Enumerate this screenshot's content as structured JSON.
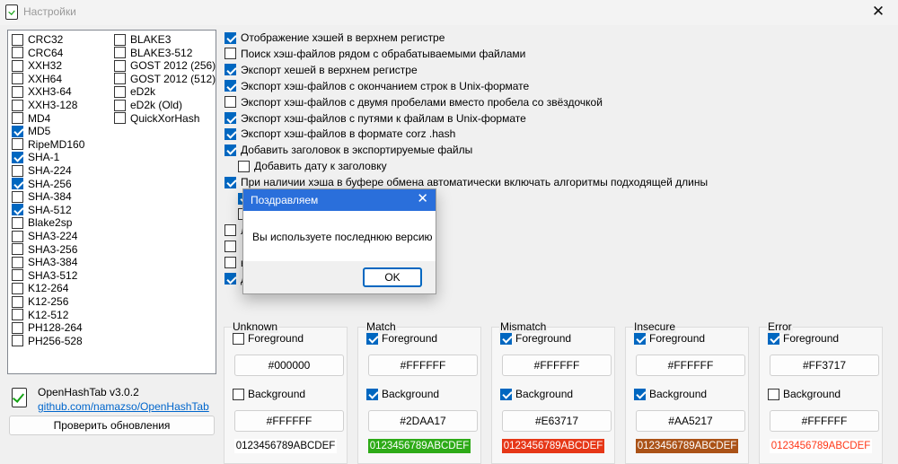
{
  "window": {
    "title": "Настройки",
    "close_glyph": "✕"
  },
  "algorithms": {
    "column1": [
      {
        "name": "CRC32",
        "checked": false
      },
      {
        "name": "CRC64",
        "checked": false
      },
      {
        "name": "XXH32",
        "checked": false
      },
      {
        "name": "XXH64",
        "checked": false
      },
      {
        "name": "XXH3-64",
        "checked": false
      },
      {
        "name": "XXH3-128",
        "checked": false
      },
      {
        "name": "MD4",
        "checked": false
      },
      {
        "name": "MD5",
        "checked": true
      },
      {
        "name": "RipeMD160",
        "checked": false
      },
      {
        "name": "SHA-1",
        "checked": true
      },
      {
        "name": "SHA-224",
        "checked": false
      },
      {
        "name": "SHA-256",
        "checked": true
      },
      {
        "name": "SHA-384",
        "checked": false
      },
      {
        "name": "SHA-512",
        "checked": true
      },
      {
        "name": "Blake2sp",
        "checked": false
      },
      {
        "name": "SHA3-224",
        "checked": false
      },
      {
        "name": "SHA3-256",
        "checked": false
      },
      {
        "name": "SHA3-384",
        "checked": false
      },
      {
        "name": "SHA3-512",
        "checked": false
      },
      {
        "name": "K12-264",
        "checked": false
      },
      {
        "name": "K12-256",
        "checked": false
      },
      {
        "name": "K12-512",
        "checked": false
      },
      {
        "name": "PH128-264",
        "checked": false
      },
      {
        "name": "PH256-528",
        "checked": false
      }
    ],
    "column2": [
      {
        "name": "BLAKE3",
        "checked": false
      },
      {
        "name": "BLAKE3-512",
        "checked": false
      },
      {
        "name": "GOST 2012 (256)",
        "checked": false
      },
      {
        "name": "GOST 2012 (512)",
        "checked": false
      },
      {
        "name": "eD2k",
        "checked": false
      },
      {
        "name": "eD2k (Old)",
        "checked": false
      },
      {
        "name": "QuickXorHash",
        "checked": false
      }
    ]
  },
  "version": {
    "label": "OpenHashTab v3.0.2",
    "link": "github.com/namazso/OpenHashTab",
    "check_updates": "Проверить обновления"
  },
  "options": [
    {
      "label": "Отображение хэшей в верхнем регистре",
      "checked": true,
      "indent": false
    },
    {
      "label": "Поиск хэш-файлов рядом с обрабатываемыми файлами",
      "checked": false,
      "indent": false
    },
    {
      "label": "Экспорт хешей в верхнем регистре",
      "checked": true,
      "indent": false
    },
    {
      "label": "Экспорт хэш-файлов с окончанием строк в Unix-формате",
      "checked": true,
      "indent": false
    },
    {
      "label": "Экспорт хэш-файлов с двумя пробелами вместо пробела со звёздочкой",
      "checked": false,
      "indent": false
    },
    {
      "label": "Экспорт хэш-файлов с путями к файлам в Unix-формате",
      "checked": true,
      "indent": false
    },
    {
      "label": "Экспорт хэш-файлов в формате corz .hash",
      "checked": true,
      "indent": false
    },
    {
      "label": "Добавить заголовок в экспортируемые файлы",
      "checked": true,
      "indent": false
    },
    {
      "label": "Добавить дату к заголовку",
      "checked": false,
      "indent": true
    },
    {
      "label": "При наличии хэша в буфере обмена автоматически включать алгоритмы подходящей длины",
      "checked": true,
      "indent": false
    },
    {
      "label": "итмы данной длины",
      "checked": true,
      "indent": true
    },
    {
      "label": "",
      "checked": false,
      "indent": true
    },
    {
      "label": "ленные в поле проверки",
      "checked": false,
      "indent": false
    },
    {
      "label": "",
      "checked": false,
      "indent": false
    },
    {
      "label": "в при их обработке",
      "checked": false,
      "indent": false
    },
    {
      "label": "данные в них алгоритмы",
      "checked": true,
      "indent": false
    }
  ],
  "color_groups": [
    {
      "title": "Unknown",
      "fg_label": "Foreground",
      "fg_checked": false,
      "fg_value": "#000000",
      "bg_label": "Background",
      "bg_checked": false,
      "bg_value": "#FFFFFF",
      "preview": "0123456789ABCDEF",
      "preview_fg": "#000000",
      "preview_bg": "#FFFFFF"
    },
    {
      "title": "Match",
      "fg_label": "Foreground",
      "fg_checked": true,
      "fg_value": "#FFFFFF",
      "bg_label": "Background",
      "bg_checked": true,
      "bg_value": "#2DAA17",
      "preview": "0123456789ABCDEF",
      "preview_fg": "#FFFFFF",
      "preview_bg": "#2DAA17"
    },
    {
      "title": "Mismatch",
      "fg_label": "Foreground",
      "fg_checked": true,
      "fg_value": "#FFFFFF",
      "bg_label": "Background",
      "bg_checked": true,
      "bg_value": "#E63717",
      "preview": "0123456789ABCDEF",
      "preview_fg": "#FFFFFF",
      "preview_bg": "#E63717"
    },
    {
      "title": "Insecure",
      "fg_label": "Foreground",
      "fg_checked": true,
      "fg_value": "#FFFFFF",
      "bg_label": "Background",
      "bg_checked": true,
      "bg_value": "#AA5217",
      "preview": "0123456789ABCDEF",
      "preview_fg": "#FFFFFF",
      "preview_bg": "#AA5217"
    },
    {
      "title": "Error",
      "fg_label": "Foreground",
      "fg_checked": true,
      "fg_value": "#FF3717",
      "bg_label": "Background",
      "bg_checked": false,
      "bg_value": "#FFFFFF",
      "preview": "0123456789ABCDEF",
      "preview_fg": "#FF3717",
      "preview_bg": "#FFFFFF"
    }
  ],
  "dialog": {
    "title": "Поздравляем",
    "message": "Вы используете последнюю версию",
    "ok": "OK",
    "close_glyph": "✕"
  },
  "colors": {
    "accent": "#0067c0",
    "dialog_title": "#2a6fdb",
    "link": "#0066cc"
  }
}
